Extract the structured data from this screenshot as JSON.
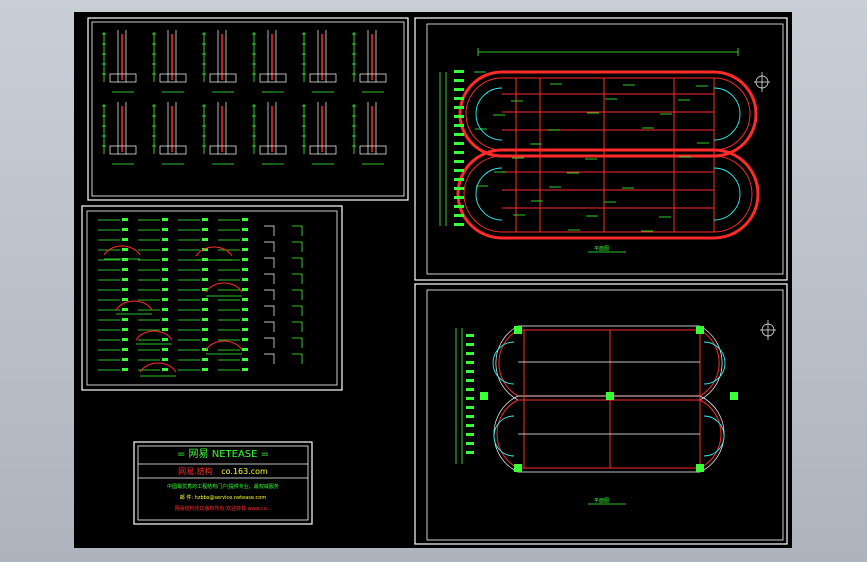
{
  "title_block": {
    "brand_line": "= 网易 NETEASE =",
    "site_name": "网易.结构",
    "site_url": "co.163.com",
    "line_1": "中国最优秀的工程结构门户|提供专业、最权威服务",
    "line_2": "邮 件: hzbbs@service.netease.com",
    "line_3": "网易结构论坛版权所有 欢迎转载 www.co..."
  },
  "sheet_titles": {
    "plan_top": "平面图",
    "plan_bottom": "平面图"
  },
  "colors": {
    "background": "#000000",
    "cad_green": "#39ff39",
    "cad_red": "#ff2a2a",
    "cad_white": "#ffffff",
    "cad_cyan": "#2ef2f2",
    "cad_yellow": "#ffff33"
  },
  "icons": {
    "north_arrow": "north-arrow-icon"
  }
}
